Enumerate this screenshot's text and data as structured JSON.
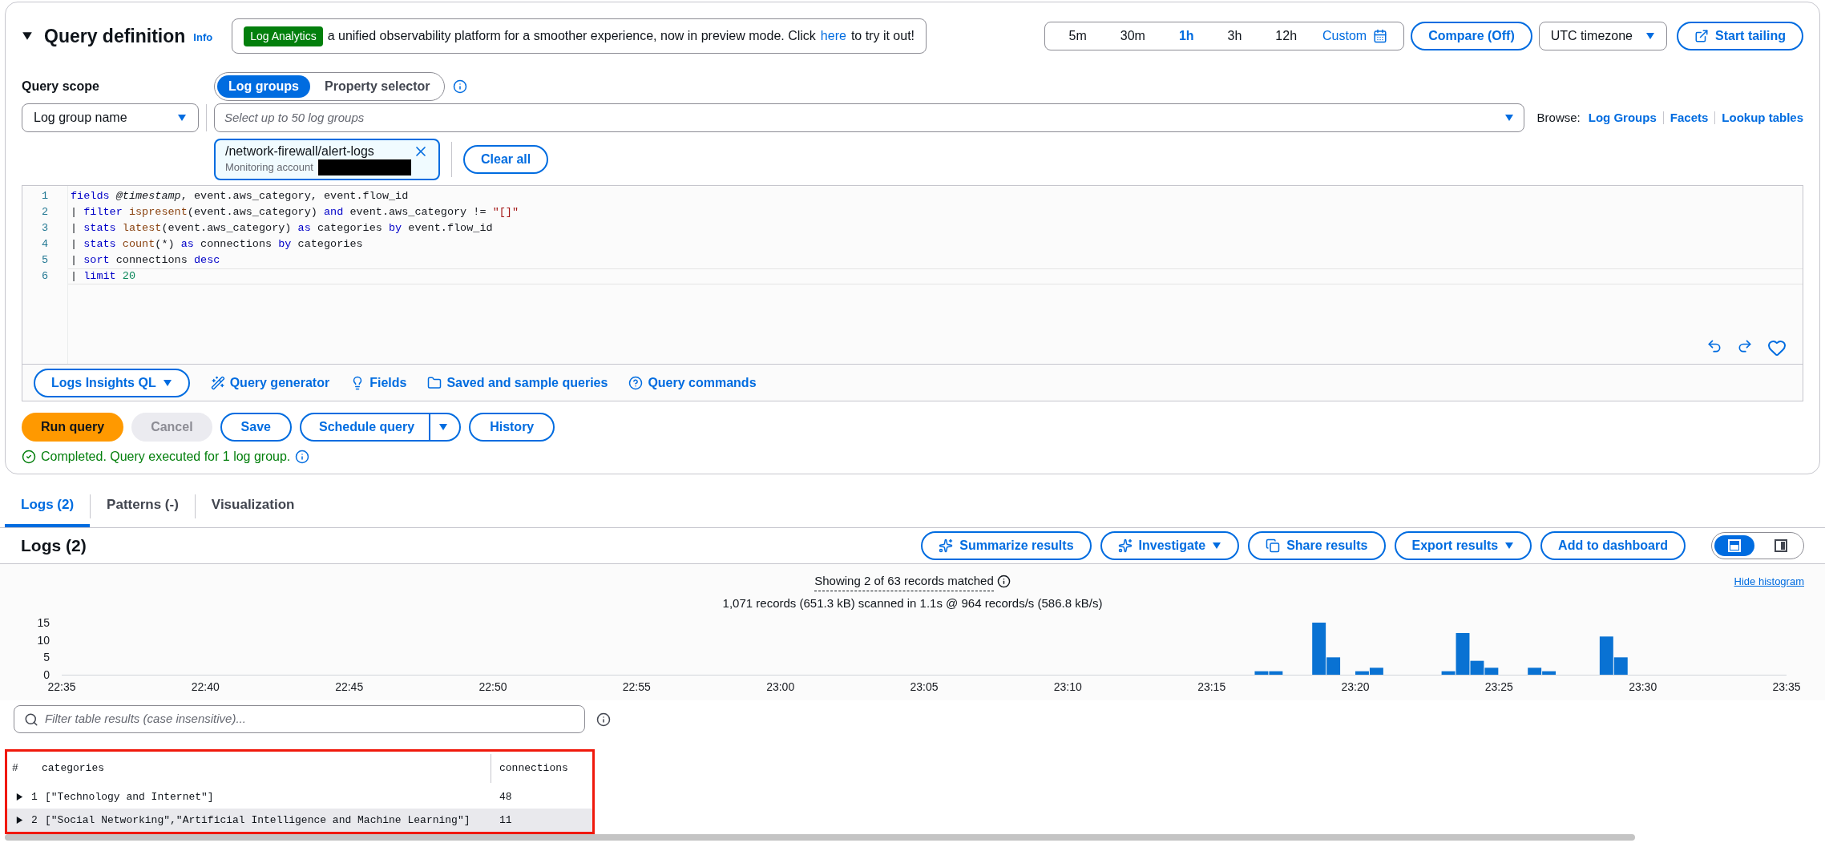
{
  "query_definition": {
    "title": "Query definition",
    "info_link": "Info",
    "expanded": true,
    "banner": {
      "badge": "Log Analytics",
      "text_before": "a unified observability platform for a smoother experience, now in preview mode. Click",
      "link": "here",
      "text_after": "to try it out!"
    },
    "time_ranges": [
      {
        "label": "5m",
        "kind": "preset",
        "selected": false
      },
      {
        "label": "30m",
        "kind": "preset",
        "selected": false
      },
      {
        "label": "1h",
        "kind": "preset",
        "selected": true
      },
      {
        "label": "3h",
        "kind": "preset",
        "selected": false
      },
      {
        "label": "12h",
        "kind": "preset",
        "selected": false
      },
      {
        "label": "Custom",
        "kind": "custom",
        "selected": false
      }
    ],
    "compare_button": "Compare (Off)",
    "timezone": "UTC timezone",
    "tail_button": "Start tailing",
    "scope_label": "Query scope",
    "scope_modes": [
      {
        "label": "Log groups",
        "selected": true
      },
      {
        "label": "Property selector",
        "selected": false
      }
    ],
    "scope_dropdown": "Log group name",
    "log_group_field": {
      "placeholder": "Select up to 50 log groups"
    },
    "browse": {
      "label": "Browse:",
      "links": [
        "Log Groups",
        "Facets",
        "Lookup tables"
      ]
    },
    "selected_groups": [
      {
        "name": "/network-firewall/alert-logs",
        "account_label": "Monitoring account"
      }
    ],
    "clear_all": "Clear all",
    "editor": {
      "lines": [
        {
          "number": "1",
          "current": false,
          "tokens": [
            {
              "kind": "keyword",
              "text": "fields"
            },
            {
              "kind": "field",
              "text": " @timestamp"
            },
            {
              "kind": "plain",
              "text": ", event.aws_category, event.flow_id"
            }
          ]
        },
        {
          "number": "2",
          "current": false,
          "tokens": [
            {
              "kind": "plain",
              "text": "| "
            },
            {
              "kind": "keyword",
              "text": "filter"
            },
            {
              "kind": "function",
              "text": " ispresent"
            },
            {
              "kind": "plain",
              "text": "(event.aws_category) "
            },
            {
              "kind": "keyword",
              "text": "and"
            },
            {
              "kind": "plain",
              "text": " event.aws_category != "
            },
            {
              "kind": "string",
              "text": "\"[]\""
            }
          ]
        },
        {
          "number": "3",
          "current": false,
          "tokens": [
            {
              "kind": "plain",
              "text": "| "
            },
            {
              "kind": "keyword",
              "text": "stats"
            },
            {
              "kind": "function",
              "text": " latest"
            },
            {
              "kind": "plain",
              "text": "(event.aws_category) "
            },
            {
              "kind": "keyword",
              "text": "as"
            },
            {
              "kind": "plain",
              "text": " categories "
            },
            {
              "kind": "keyword",
              "text": "by"
            },
            {
              "kind": "plain",
              "text": " event.flow_id"
            }
          ]
        },
        {
          "number": "4",
          "current": false,
          "tokens": [
            {
              "kind": "plain",
              "text": "| "
            },
            {
              "kind": "keyword",
              "text": "stats"
            },
            {
              "kind": "function",
              "text": " count"
            },
            {
              "kind": "plain",
              "text": "(*) "
            },
            {
              "kind": "keyword",
              "text": "as"
            },
            {
              "kind": "plain",
              "text": " connections "
            },
            {
              "kind": "keyword",
              "text": "by"
            },
            {
              "kind": "plain",
              "text": " categories"
            }
          ]
        },
        {
          "number": "5",
          "current": false,
          "tokens": [
            {
              "kind": "plain",
              "text": "| "
            },
            {
              "kind": "keyword",
              "text": "sort"
            },
            {
              "kind": "plain",
              "text": " connections "
            },
            {
              "kind": "keyword",
              "text": "desc"
            }
          ]
        },
        {
          "number": "6",
          "current": true,
          "tokens": [
            {
              "kind": "plain",
              "text": "| "
            },
            {
              "kind": "keyword",
              "text": "limit"
            },
            {
              "kind": "number",
              "text": " 20"
            }
          ]
        }
      ]
    },
    "language_dropdown": "Logs Insights QL",
    "tools": [
      {
        "kind": "generator",
        "label": "Query generator"
      },
      {
        "kind": "fields",
        "label": "Fields"
      },
      {
        "kind": "saved",
        "label": "Saved and sample queries"
      },
      {
        "kind": "commands",
        "label": "Query commands"
      }
    ],
    "actions": [
      {
        "kind": "primary",
        "label": "Run query",
        "disabled": false
      },
      {
        "kind": "normal",
        "label": "Cancel",
        "disabled": true
      },
      {
        "kind": "normal",
        "label": "Save",
        "disabled": false
      },
      {
        "kind": "split",
        "label": "Schedule query",
        "disabled": false
      },
      {
        "kind": "normal",
        "label": "History",
        "disabled": false
      }
    ],
    "status": "Completed. Query executed for 1 log group."
  },
  "result_tabs": [
    {
      "label": "Logs (2)",
      "selected": true
    },
    {
      "label": "Patterns (-)",
      "selected": false
    },
    {
      "label": "Visualization",
      "selected": false
    }
  ],
  "logs": {
    "title": "Logs (2)",
    "actions": [
      {
        "label": "Summarize results",
        "kind": "sparkle",
        "menu": false
      },
      {
        "label": "Investigate",
        "kind": "sparkle",
        "menu": true
      },
      {
        "label": "Share results",
        "kind": "copy",
        "menu": false
      },
      {
        "label": "Export results",
        "kind": "plain",
        "menu": true
      },
      {
        "label": "Add to dashboard",
        "kind": "plain",
        "menu": false
      }
    ],
    "view_modes": [
      {
        "kind": "bottom",
        "selected": true
      },
      {
        "kind": "side",
        "selected": false
      }
    ],
    "summary": "Showing 2 of 63 records matched",
    "stats": "1,071 records (651.3 kB) scanned in 1.1s @ 964 records/s (586.8 kB/s)",
    "hide_histogram": "Hide histogram",
    "histogram": {
      "chart_data": {
        "type": "bar",
        "ylim": [
          0,
          15
        ],
        "categories": [
          "22:35",
          null,
          null,
          null,
          null,
          null,
          null,
          null,
          null,
          null,
          "22:40",
          null,
          null,
          null,
          null,
          null,
          null,
          null,
          null,
          null,
          "22:45",
          null,
          null,
          null,
          null,
          null,
          null,
          null,
          null,
          null,
          "22:50",
          null,
          null,
          null,
          null,
          null,
          null,
          null,
          null,
          null,
          "22:55",
          null,
          null,
          null,
          null,
          null,
          null,
          null,
          null,
          null,
          "23:00",
          null,
          null,
          null,
          null,
          null,
          null,
          null,
          null,
          null,
          "23:05",
          null,
          null,
          null,
          null,
          null,
          null,
          null,
          null,
          null,
          "23:10",
          null,
          null,
          null,
          null,
          null,
          null,
          null,
          null,
          null,
          "23:15",
          null,
          null,
          null,
          null,
          null,
          null,
          null,
          null,
          null,
          "23:20",
          null,
          null,
          null,
          null,
          null,
          null,
          null,
          null,
          null,
          "23:25",
          null,
          null,
          null,
          null,
          null,
          null,
          null,
          null,
          null,
          "23:30",
          null,
          null,
          null,
          null,
          null,
          null,
          null,
          null,
          null,
          "23:35"
        ],
        "series": [
          {
            "color": "#0972d3",
            "values": [
              0,
              0,
              0,
              0,
              0,
              0,
              0,
              0,
              0,
              0,
              0,
              0,
              0,
              0,
              0,
              0,
              0,
              0,
              0,
              0,
              0,
              0,
              0,
              0,
              0,
              0,
              0,
              0,
              0,
              0,
              0,
              0,
              0,
              0,
              0,
              0,
              0,
              0,
              0,
              0,
              0,
              0,
              0,
              0,
              0,
              0,
              0,
              0,
              0,
              0,
              0,
              0,
              0,
              0,
              0,
              0,
              0,
              0,
              0,
              0,
              0,
              0,
              0,
              0,
              0,
              0,
              0,
              0,
              0,
              0,
              0,
              0,
              0,
              0,
              0,
              0,
              0,
              0,
              0,
              0,
              0,
              0,
              0,
              1,
              1,
              0,
              0,
              15,
              5,
              0,
              1,
              2,
              0,
              0,
              0,
              0,
              1,
              12,
              4,
              2,
              0,
              0,
              2,
              1,
              0,
              0,
              0,
              11,
              5,
              0,
              0,
              0,
              0,
              0,
              0,
              0,
              0,
              0,
              0,
              0,
              0
            ]
          }
        ],
        "yticks": [
          0,
          5,
          10,
          15
        ]
      }
    },
    "filter": {
      "placeholder": "Filter table results (case insensitive)..."
    },
    "table": {
      "columns": [
        "#",
        "categories",
        "connections"
      ],
      "rows": [
        {
          "index": "1",
          "categories": "[\"Technology and Internet\"]",
          "connections": "48",
          "expanded": false,
          "highlighted": false
        },
        {
          "index": "2",
          "categories": "[\"Social Networking\",\"Artificial Intelligence and Machine Learning\"]",
          "connections": "11",
          "expanded": false,
          "highlighted": true
        }
      ]
    }
  }
}
